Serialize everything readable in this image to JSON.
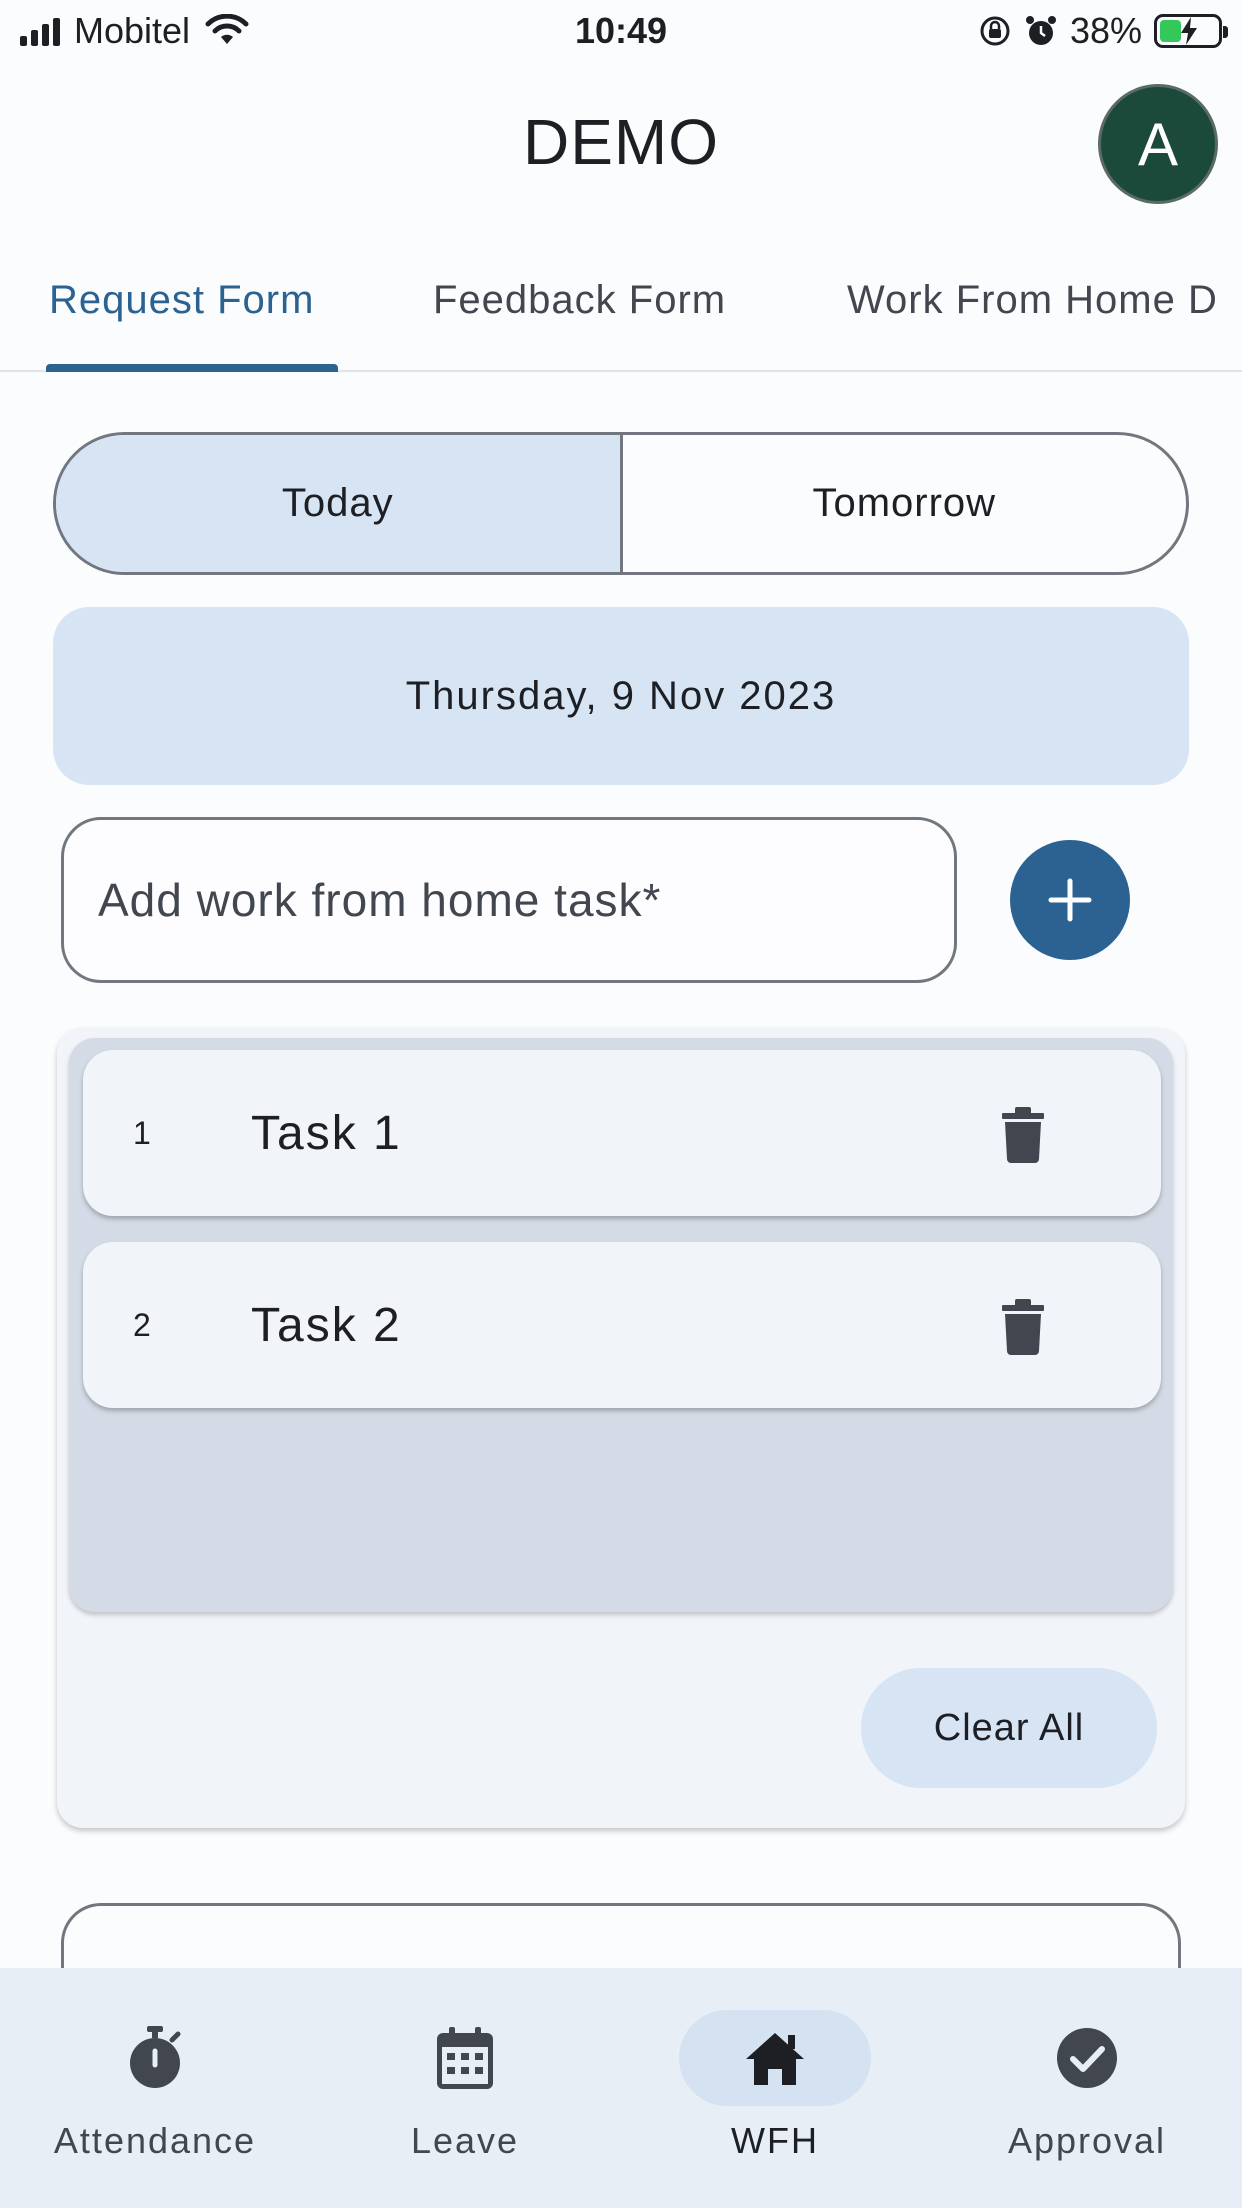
{
  "status_bar": {
    "carrier": "Mobitel",
    "time": "10:49",
    "battery_percent": "38%",
    "icons": [
      "signal-icon",
      "wifi-icon",
      "orientation-lock-icon",
      "alarm-icon",
      "battery-charging-icon"
    ]
  },
  "app_bar": {
    "title": "DEMO",
    "avatar_initial": "A",
    "avatar_color": "#1b4a3a"
  },
  "tabs": [
    {
      "label": "Request Form",
      "active": true
    },
    {
      "label": "Feedback Form",
      "active": false
    },
    {
      "label": "Work From Home D",
      "active": false
    }
  ],
  "day_selector": {
    "options": [
      "Today",
      "Tomorrow"
    ],
    "selected": "Today"
  },
  "date_card": {
    "text": "Thursday, 9 Nov 2023"
  },
  "task_entry": {
    "placeholder": "Add work from home task*",
    "value": "",
    "add_icon": "plus-icon"
  },
  "tasks": [
    {
      "number": "1",
      "title": "Task 1",
      "icon": "trash-icon"
    },
    {
      "number": "2",
      "title": "Task 2",
      "icon": "trash-icon"
    }
  ],
  "clear_all_label": "Clear All",
  "bottom_nav": [
    {
      "label": "Attendance",
      "icon": "stopwatch-icon",
      "active": false
    },
    {
      "label": "Leave",
      "icon": "calendar-icon",
      "active": false
    },
    {
      "label": "WFH",
      "icon": "home-icon",
      "active": true
    },
    {
      "label": "Approval",
      "icon": "check-circle-icon",
      "active": false
    }
  ],
  "colors": {
    "primary": "#2b6291",
    "selected_container": "#d6e4f4",
    "background": "#fbfcfe",
    "nav_background": "#e7eef6"
  }
}
